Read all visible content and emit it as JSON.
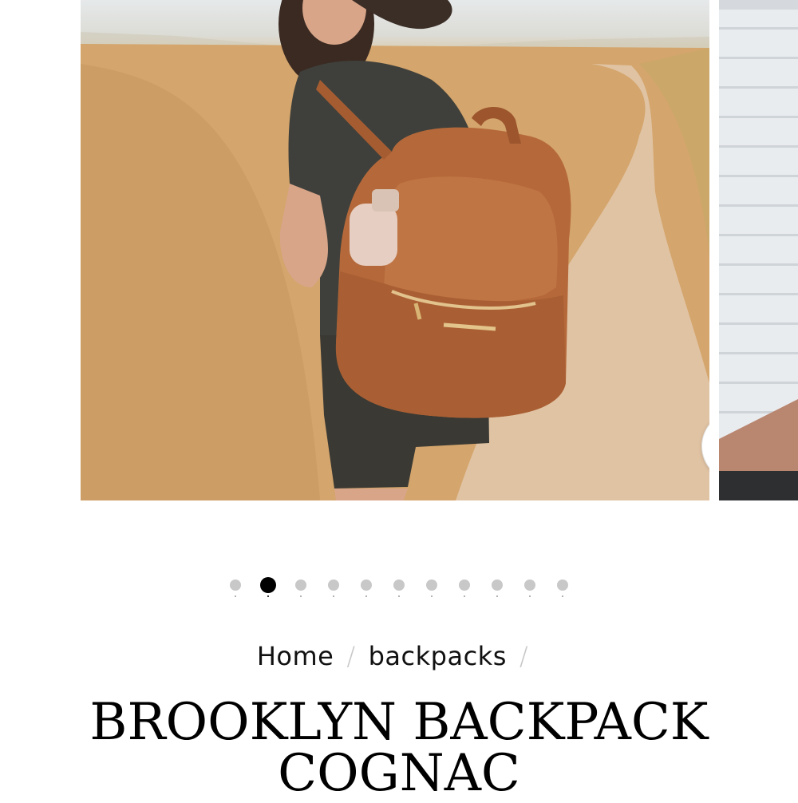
{
  "product": {
    "title_line1": "BROOKLYN BACKPACK",
    "title_line2": "COGNAC"
  },
  "breadcrumb": {
    "items": [
      "Home",
      "backpacks"
    ],
    "separator": "/"
  },
  "gallery": {
    "total_slides": 11,
    "active_index": 1
  },
  "icons": {
    "zoom": "search-icon"
  },
  "colors": {
    "dot_inactive": "#c8c8c8",
    "dot_active": "#000000",
    "backpack": "#b5693a"
  }
}
